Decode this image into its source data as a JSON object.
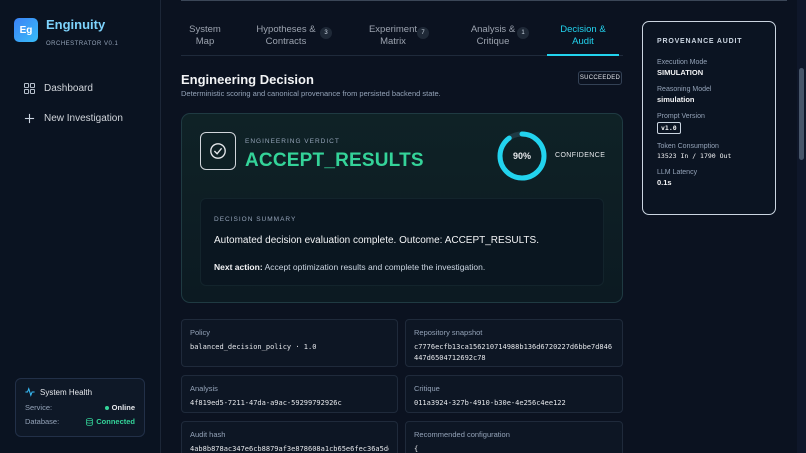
{
  "app": {
    "logo": "Eg",
    "name": "Enginuity",
    "subtitle": "ORCHESTRATOR V0.1"
  },
  "nav": [
    {
      "label": "Dashboard",
      "icon": "grid-icon"
    },
    {
      "label": "New Investigation",
      "icon": "plus-icon"
    }
  ],
  "health": {
    "title": "System Health",
    "service_label": "Service:",
    "service_value": "Online",
    "database_label": "Database:",
    "database_value": "Connected"
  },
  "tabs": [
    {
      "label": "System Map",
      "badge": ""
    },
    {
      "label": "Hypotheses & Contracts",
      "badge": "3"
    },
    {
      "label": "Experiment Matrix",
      "badge": "7"
    },
    {
      "label": "Analysis & Critique",
      "badge": "1"
    },
    {
      "label": "Decision & Audit",
      "badge": "",
      "active": true
    }
  ],
  "header": {
    "title": "Engineering Decision",
    "subtitle": "Deterministic scoring and canonical provenance from persisted backend state.",
    "status": "SUCCEEDED"
  },
  "verdict": {
    "label": "ENGINEERING VERDICT",
    "value": "ACCEPT_RESULTS",
    "confidence": 90,
    "confidence_text": "90%",
    "confidence_label": "CONFIDENCE",
    "summary_label": "DECISION SUMMARY",
    "summary": "Automated decision evaluation complete. Outcome: ACCEPT_RESULTS.",
    "next_action_label": "Next action:",
    "next_action": "Accept optimization results and complete the investigation."
  },
  "cards": {
    "policy": {
      "label": "Policy",
      "value": "balanced_decision_policy · 1.0"
    },
    "repo": {
      "label": "Repository snapshot",
      "value": "c7776ecfb13ca156210714988b136d6720227d6bbe7d846447d6504712692c78"
    },
    "analysis": {
      "label": "Analysis",
      "value": "4f819ed5-7211-47da-a9ac-59299792926c"
    },
    "critique": {
      "label": "Critique",
      "value": "011a3924-327b-4910-b30e-4e256c4ee122"
    },
    "audit": {
      "label": "Audit hash",
      "value": "4ab8b878ac347e6cb8879af3e878608a1cb65e6fec36a5de"
    },
    "recommended": {
      "label": "Recommended configuration",
      "value": "{"
    }
  },
  "provenance": {
    "title": "PROVENANCE AUDIT",
    "execution_mode_label": "Execution Mode",
    "execution_mode": "SIMULATION",
    "reasoning_model_label": "Reasoning Model",
    "reasoning_model": "simulation",
    "prompt_version_label": "Prompt Version",
    "prompt_version": "v1.0",
    "token_label": "Token Consumption",
    "token_value": "13523 In / 1790 Out",
    "latency_label": "LLM Latency",
    "latency": "0.1s"
  },
  "colors": {
    "accent": "#22d3ee",
    "success": "#34d399"
  }
}
